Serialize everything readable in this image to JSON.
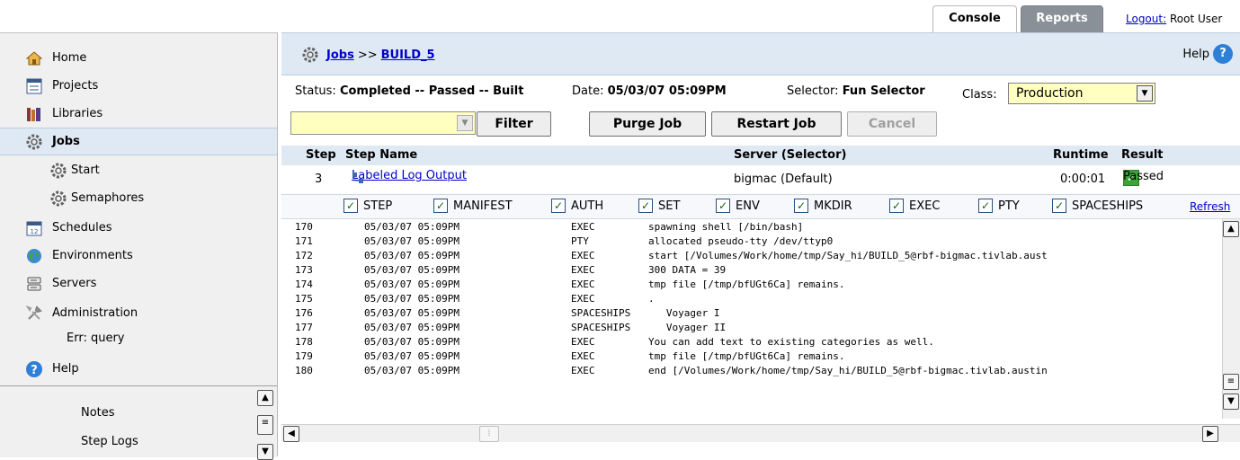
{
  "top_tabs": {
    "console": "Console",
    "reports": "Reports",
    "logout_link": "Logout:",
    "user": "Root User"
  },
  "sidebar": {
    "items": [
      {
        "label": "Home",
        "icon": "home-icon"
      },
      {
        "label": "Projects",
        "icon": "projects-icon"
      },
      {
        "label": "Libraries",
        "icon": "libraries-icon"
      },
      {
        "label": "Jobs",
        "icon": "gear-icon",
        "active": true
      },
      {
        "label": "Start",
        "icon": "gear-icon"
      },
      {
        "label": "Semaphores",
        "icon": "gear-icon"
      },
      {
        "label": "Schedules",
        "icon": "calendar-icon"
      },
      {
        "label": "Environments",
        "icon": "globe-icon"
      },
      {
        "label": "Servers",
        "icon": "server-icon"
      },
      {
        "label": "Administration",
        "icon": "tools-icon"
      },
      {
        "label": "Help",
        "icon": "help-icon"
      }
    ],
    "err_text": "Err: query",
    "lower": {
      "notes": "Notes",
      "step_logs": "Step Logs"
    }
  },
  "breadcrumb": {
    "jobs": "Jobs",
    "sep": ">>",
    "build": "BUILD_5",
    "help": "Help"
  },
  "status": {
    "status_label": "Status:",
    "status_value": "Completed -- Passed -- Built",
    "date_label": "Date:",
    "date_value": "05/03/07 05:09PM",
    "selector_label": "Selector:",
    "selector_value": "Fun Selector",
    "class_label": "Class:",
    "class_value": "Production"
  },
  "buttons": {
    "filter": "Filter",
    "purge": "Purge Job",
    "restart": "Restart Job",
    "cancel": "Cancel"
  },
  "step_table": {
    "headers": {
      "step": "Step",
      "step_name": "Step Name",
      "server": "Server (Selector)",
      "runtime": "Runtime",
      "result": "Result"
    },
    "row": {
      "step": "3",
      "step_name": "Labeled Log Output",
      "server": "bigmac (Default)",
      "runtime": "0:00:01",
      "result": "Passed"
    }
  },
  "log_filters": [
    "STEP",
    "MANIFEST",
    "AUTH",
    "SET",
    "ENV",
    "MKDIR",
    "EXEC",
    "PTY",
    "SPACESHIPS"
  ],
  "refresh": "Refresh",
  "log_lines": [
    {
      "n": "170",
      "date": "05/03/07 05:09PM",
      "cat": "EXEC",
      "msg": "spawning shell [/bin/bash]"
    },
    {
      "n": "171",
      "date": "05/03/07 05:09PM",
      "cat": "PTY",
      "msg": "allocated pseudo-tty /dev/ttyp0"
    },
    {
      "n": "172",
      "date": "05/03/07 05:09PM",
      "cat": "EXEC",
      "msg": "start [/Volumes/Work/home/tmp/Say_hi/BUILD_5@rbf-bigmac.tivlab.aust"
    },
    {
      "n": "173",
      "date": "05/03/07 05:09PM",
      "cat": "EXEC",
      "msg": "300 DATA = 39"
    },
    {
      "n": "174",
      "date": "05/03/07 05:09PM",
      "cat": "EXEC",
      "msg": "tmp file [/tmp/bfUGt6Ca] remains."
    },
    {
      "n": "175",
      "date": "05/03/07 05:09PM",
      "cat": "EXEC",
      "msg": "."
    },
    {
      "n": "176",
      "date": "05/03/07 05:09PM",
      "cat": "SPACESHIPS",
      "msg": "   Voyager I"
    },
    {
      "n": "177",
      "date": "05/03/07 05:09PM",
      "cat": "SPACESHIPS",
      "msg": "   Voyager II"
    },
    {
      "n": "178",
      "date": "05/03/07 05:09PM",
      "cat": "EXEC",
      "msg": "You can add text to existing categories as well."
    },
    {
      "n": "179",
      "date": "05/03/07 05:09PM",
      "cat": "EXEC",
      "msg": "tmp file [/tmp/bfUGt6Ca] remains."
    },
    {
      "n": "180",
      "date": "05/03/07 05:09PM",
      "cat": "EXEC",
      "msg": "end [/Volumes/Work/home/tmp/Say_hi/BUILD_5@rbf-bigmac.tivlab.austin"
    }
  ]
}
